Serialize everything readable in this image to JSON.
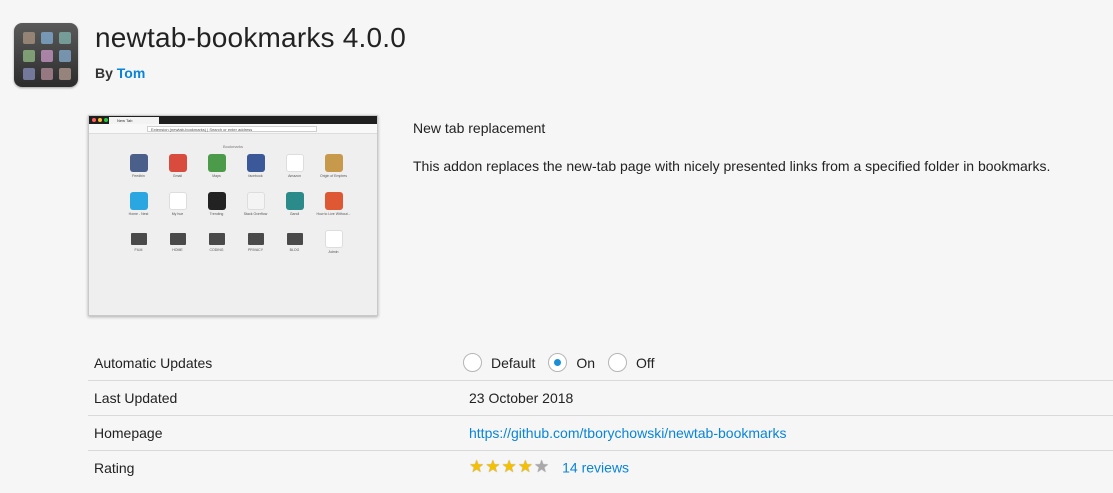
{
  "header": {
    "title": "newtab-bookmarks 4.0.0",
    "by_label": "By",
    "author": "Tom",
    "icon_colors": [
      "#9c8a7a",
      "#7aa0c0",
      "#7aa4a0",
      "#86a77a",
      "#b58bb0",
      "#7b9cb8",
      "#7b7fa6",
      "#a07f8a",
      "#a08c84"
    ]
  },
  "screenshot": {
    "tab_label": "New Tab",
    "url_text": "Extension (newtab-bookmarks)  |  Search or enter address",
    "bookmarks_title": "Bookmarks",
    "items": [
      {
        "label": "Feedbin",
        "color": "#4a5f8a"
      },
      {
        "label": "Gmail",
        "color": "#d94b3c"
      },
      {
        "label": "Maps",
        "color": "#4c9b4a"
      },
      {
        "label": "facebook",
        "color": "#3b5998"
      },
      {
        "label": "Amazon",
        "color": "#ffffff"
      },
      {
        "label": "Origin of Empires",
        "color": "#c79a4b"
      },
      {
        "label": "Home - Nest",
        "color": "#2aa7e0"
      },
      {
        "label": "My hue",
        "color": "#ffffff"
      },
      {
        "label": "Trending",
        "color": "#222222"
      },
      {
        "label": "Stack Overflow",
        "color": "#f4f4f4"
      },
      {
        "label": "Gandi",
        "color": "#2b8a8a"
      },
      {
        "label": "How to Live Without...",
        "color": "#de5833"
      },
      {
        "label": "FILM",
        "folder": true
      },
      {
        "label": "HOME",
        "folder": true
      },
      {
        "label": "CODING",
        "folder": true
      },
      {
        "label": "PRIVACY",
        "folder": true
      },
      {
        "label": "BLOG",
        "folder": true
      },
      {
        "label": "Admin",
        "color": "#ffffff"
      }
    ]
  },
  "description": {
    "summary": "New tab replacement",
    "full": "This addon replaces the new-tab page with nicely presented links from a specified folder in bookmarks."
  },
  "details": {
    "auto_updates_label": "Automatic Updates",
    "auto_updates_options": [
      "Default",
      "On",
      "Off"
    ],
    "auto_updates_selected": "On",
    "last_updated_label": "Last Updated",
    "last_updated_value": "23 October 2018",
    "homepage_label": "Homepage",
    "homepage_value": "https://github.com/tborychowski/newtab-bookmarks",
    "rating_label": "Rating",
    "rating_value": 4,
    "rating_max": 5,
    "reviews_link": "14 reviews"
  },
  "colors": {
    "accent": "#0a84d9",
    "radio_selected": "#1a8fd6",
    "star_filled": "#f5c000",
    "star_empty": "#a8a8a8"
  }
}
